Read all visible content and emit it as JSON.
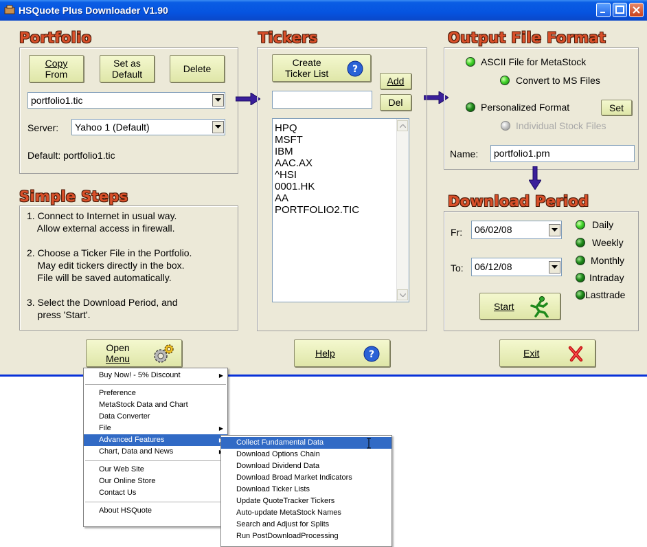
{
  "window": {
    "title": "HSQuote Plus Downloader V1.90",
    "accent": "#0a5de4",
    "section_title_color": "#d9502a"
  },
  "portfolio": {
    "heading": "Portfolio",
    "copy_from_line1": "Copy",
    "copy_from_line2": "From",
    "set_default_line1": "Set as",
    "set_default_line2": "Default",
    "delete_label": "Delete",
    "file_value": "portfolio1.tic",
    "server_label": "Server:",
    "server_value": "Yahoo 1 (Default)",
    "default_text": "Default: portfolio1.tic"
  },
  "steps": {
    "heading": "Simple Steps",
    "items": [
      "1. Connect to Internet in usual way.\n    Allow external access in firewall.",
      "2. Choose a Ticker File in the Portfolio.\n    May edit tickers directly in the box.\n    File will be saved automatically.",
      "3. Select the Download Period, and\n    press 'Start'."
    ]
  },
  "tickers": {
    "heading": "Tickers",
    "create_line1": "Create",
    "create_line2": "Ticker List",
    "add_label": "Add",
    "del_label": "Del",
    "input_value": "",
    "list": [
      "HPQ",
      "MSFT",
      "IBM",
      "AAC.AX",
      "^HSI",
      "0001.HK",
      "AA",
      "PORTFOLIO2.TIC"
    ]
  },
  "output": {
    "heading": "Output File Format",
    "ascii_label": "ASCII File for MetaStock",
    "convert_label": "Convert to MS Files",
    "personal_label": "Personalized Format",
    "set_label": "Set",
    "individual_label": "Individual Stock Files",
    "name_label": "Name:",
    "name_value": "portfolio1.prn"
  },
  "period": {
    "heading": "Download Period",
    "from_label": "Fr:",
    "from_value": "06/02/08",
    "to_label": "To:",
    "to_value": "06/12/08",
    "start_label": "Start",
    "options": [
      "Daily",
      "Weekly",
      "Monthly",
      "Intraday",
      "Lasttrade"
    ]
  },
  "bottom": {
    "open_line1": "Open",
    "open_line2": "Menu",
    "help_label": "Help",
    "exit_label": "Exit"
  },
  "menu": {
    "items": [
      "Buy Now! - 5% Discount",
      "Preference",
      "MetaStock Data and Chart",
      "Data Converter",
      "File",
      "Advanced Features",
      "Chart, Data and News",
      "Our Web Site",
      "Our Online Store",
      "Contact Us",
      "About HSQuote"
    ]
  },
  "submenu": {
    "items": [
      "Collect Fundamental Data",
      "Download Options Chain",
      "Download Dividend Data",
      "Download Broad Market Indicators",
      "Download Ticker Lists",
      "Update QuoteTracker Tickers",
      "Auto-update MetaStock Names",
      "Search and Adjust for Splits",
      "Run PostDownloadProcessing"
    ]
  }
}
